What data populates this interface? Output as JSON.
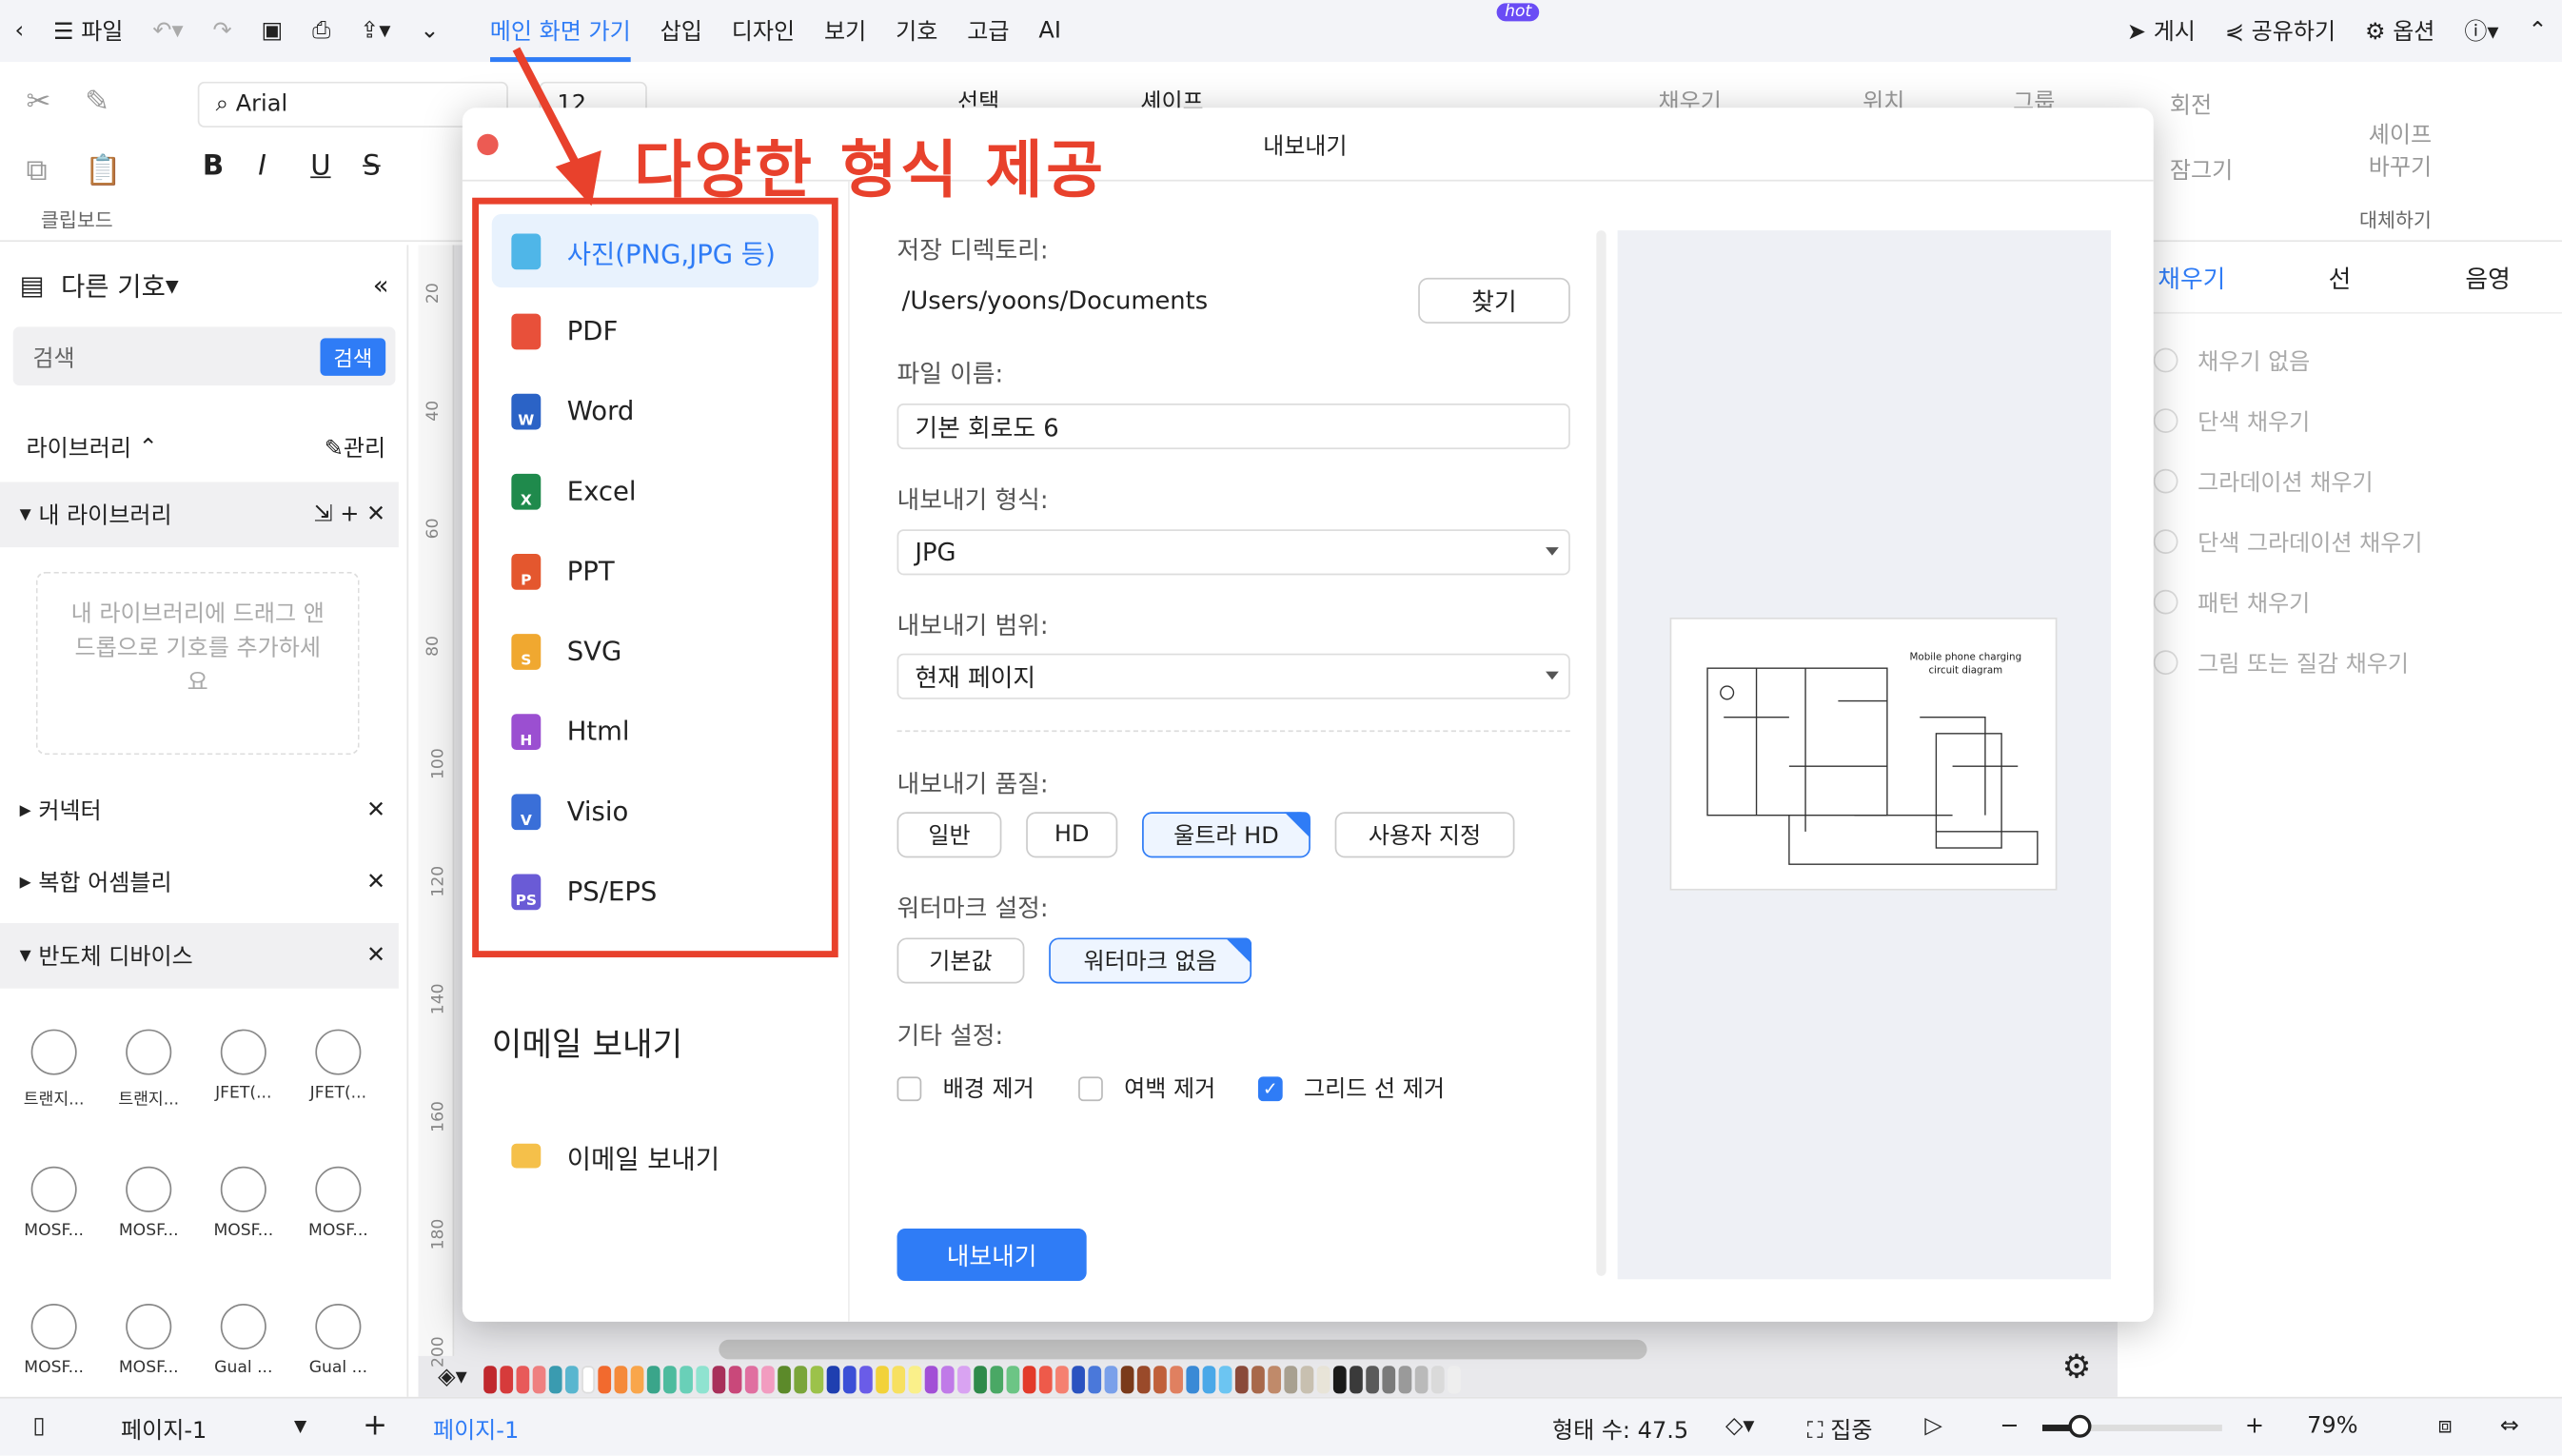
{
  "topbar": {
    "file": "파일",
    "tabs": [
      "메인 화면 가기",
      "삽입",
      "디자인",
      "보기",
      "기호",
      "고급",
      "AI"
    ],
    "hot": "hot",
    "publish": "게시",
    "share": "공유하기",
    "options": "옵션"
  },
  "ribbon": {
    "font": "Arial",
    "size": "12",
    "select": "선택",
    "shape": "셰이프",
    "fill": "채우기",
    "position": "위치",
    "group": "그룹",
    "rotate": "회전",
    "lock": "잠그기",
    "replace_shape": "셰이프 바꾸기",
    "replace": "대체하기",
    "clipboard": "클립보드"
  },
  "sidebar": {
    "title": "다른 기호",
    "search_placeholder": "검색",
    "search_button": "검색",
    "library": "라이브러리",
    "manage": "관리",
    "my_library": "내 라이브러리",
    "drop_hint": "내 라이브러리에 드래그 앤 드롭으로 기호를 추가하세요",
    "sections": [
      "커넥터",
      "복합 어셈블리",
      "반도체 디바이스"
    ],
    "shapes": [
      "트랜지...",
      "트랜지...",
      "JFET(...",
      "JFET(...",
      "MOSF...",
      "MOSF...",
      "MOSF...",
      "MOSF...",
      "MOSF...",
      "MOSF...",
      "Gual ...",
      "Gual ..."
    ]
  },
  "ruler": [
    "20",
    "40",
    "60",
    "80",
    "100",
    "120",
    "140",
    "160",
    "180",
    "200"
  ],
  "right_panel": {
    "tabs": [
      "채우기",
      "선",
      "음영"
    ],
    "options": [
      "채우기 없음",
      "단색 채우기",
      "그라데이션 채우기",
      "단색 그라데이션 채우기",
      "패턴 채우기",
      "그림 또는 질감 채우기"
    ]
  },
  "dialog": {
    "title": "내보내기",
    "formats": [
      {
        "label": "사진(PNG,JPG 등)",
        "icon": "image",
        "color": "#4fb6e8"
      },
      {
        "label": "PDF",
        "icon": "pdf",
        "color": "#e8503a"
      },
      {
        "label": "Word",
        "icon": "W",
        "color": "#2b63c6"
      },
      {
        "label": "Excel",
        "icon": "X",
        "color": "#1f8a4c"
      },
      {
        "label": "PPT",
        "icon": "P",
        "color": "#e4572e"
      },
      {
        "label": "SVG",
        "icon": "S",
        "color": "#f0a830"
      },
      {
        "label": "Html",
        "icon": "H",
        "color": "#9b4fd1"
      },
      {
        "label": "Visio",
        "icon": "V",
        "color": "#3a6fd8"
      },
      {
        "label": "PS/EPS",
        "icon": "PS",
        "color": "#6a5bd6"
      }
    ],
    "email_title": "이메일 보내기",
    "email_item": "이메일 보내기",
    "dir_label": "저장 디렉토리:",
    "dir_value": "/Users/yoons/Documents",
    "browse": "찾기",
    "name_label": "파일 이름:",
    "name_value": "기본 회로도 6",
    "format_label": "내보내기 형식:",
    "format_value": "JPG",
    "range_label": "내보내기 범위:",
    "range_value": "현재 페이지",
    "quality_label": "내보내기 품질:",
    "quality": [
      "일반",
      "HD",
      "울트라 HD",
      "사용자 지정"
    ],
    "quality_selected": "울트라 HD",
    "watermark_label": "워터마크 설정:",
    "watermark": [
      "기본값",
      "워터마크 없음"
    ],
    "watermark_selected": "워터마크 없음",
    "other_label": "기타 설정:",
    "other": [
      {
        "label": "배경 제거",
        "checked": false
      },
      {
        "label": "여백 제거",
        "checked": false
      },
      {
        "label": "그리드 선 제거",
        "checked": true
      }
    ],
    "export_button": "내보내기",
    "preview_title": "Mobile phone charging circuit diagram"
  },
  "annotation": "다양한 형식 제공",
  "bottombar": {
    "page_select": "페이지-1",
    "page_tab": "페이지-1",
    "shape_count": "형태 수: 47.5",
    "focus": "집중",
    "zoom": "79%",
    "zoom_level": 0.79
  },
  "palette": [
    "#c0282d",
    "#d63b3b",
    "#e85a5a",
    "#ef8080",
    "#3a9bb0",
    "#59b6cf",
    "#ffffff",
    "#f26a2e",
    "#f58a3a",
    "#f9a64b",
    "#3aa58a",
    "#4dbb9e",
    "#69d0b8",
    "#8fe3d0",
    "#a8305a",
    "#c9487a",
    "#e06fa0",
    "#f29cc0",
    "#5c8a2a",
    "#7aa53a",
    "#9cc24a",
    "#1f3fb0",
    "#3b4fd6",
    "#6a5ce8",
    "#f2d23a",
    "#f7e060",
    "#faf08a",
    "#a24fd6",
    "#c07ae8",
    "#d9a3f2",
    "#2f8a4a",
    "#4aa865",
    "#6cc585",
    "#e33a2a",
    "#ee5a4a",
    "#f58070",
    "#2a52c0",
    "#4a78da",
    "#7aa0ea",
    "#7a3a1a",
    "#9a4a2a",
    "#c0603a",
    "#e08060",
    "#3a8ad6",
    "#4aa8e8",
    "#6cc5f2",
    "#8a4a3a",
    "#a8684a",
    "#c08a6a",
    "#a8a090",
    "#c8c0b0",
    "#e8e4d8",
    "#1a1a1a",
    "#3a3a3a",
    "#5a5a5a",
    "#7a7a7a",
    "#9a9a9a",
    "#bababa",
    "#dadada",
    "#eeeeee"
  ]
}
